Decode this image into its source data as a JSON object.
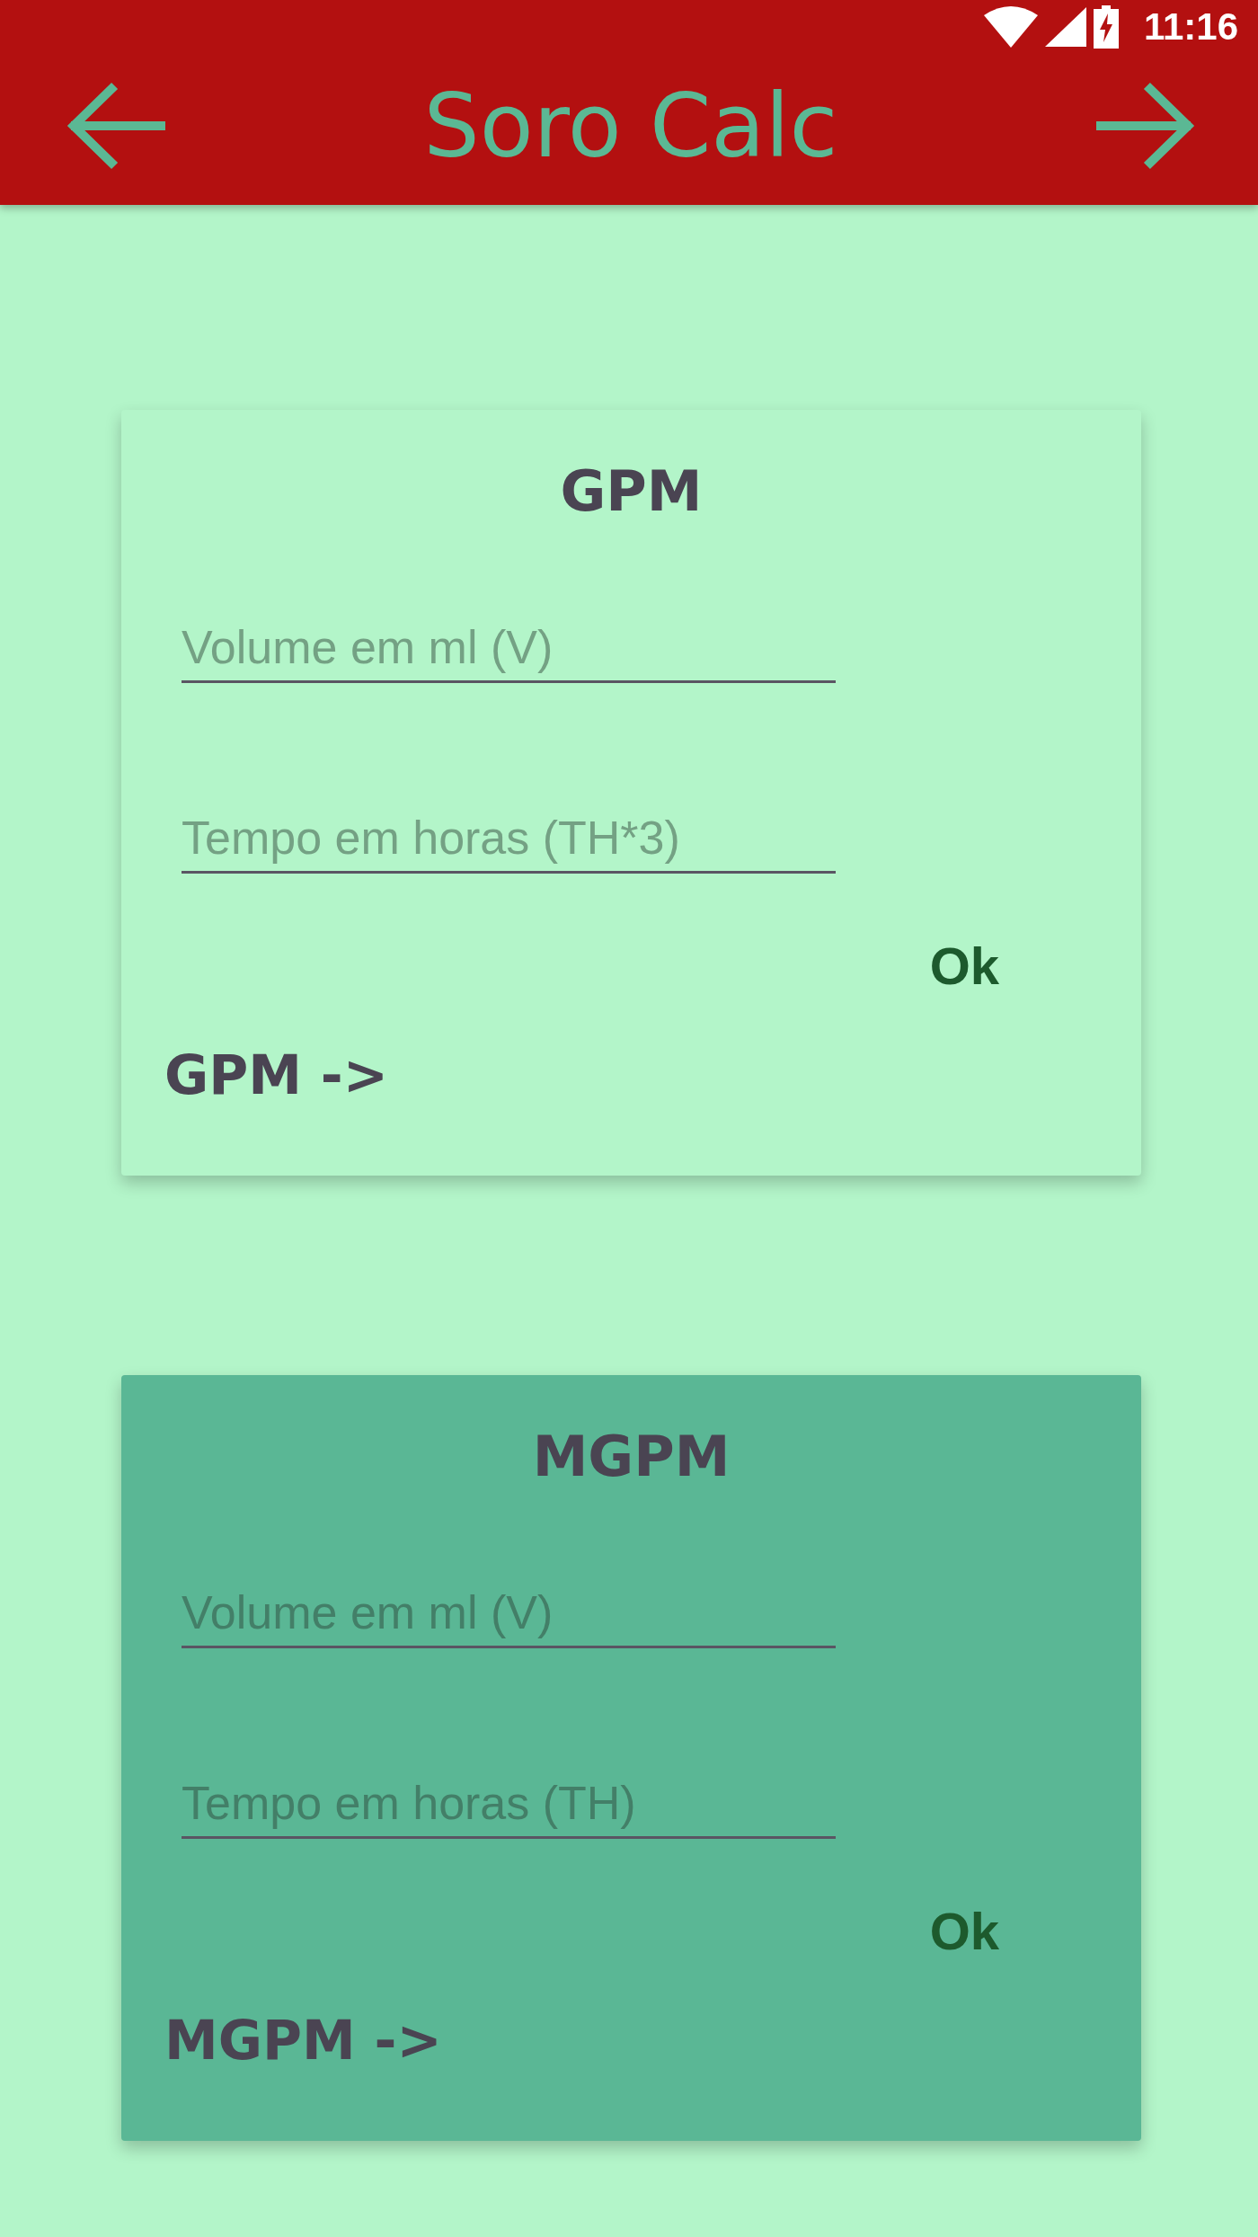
{
  "status_bar": {
    "time": "11:16"
  },
  "app_bar": {
    "title": "Soro Calc"
  },
  "cards": [
    {
      "title": "GPM",
      "color": "#b3f5c9",
      "fields": [
        {
          "placeholder": "Volume em ml (V)"
        },
        {
          "placeholder": "Tempo em horas (TH*3)"
        }
      ],
      "button": "Ok",
      "result": "GPM ->"
    },
    {
      "title": "MGPM",
      "color": "#5ab795",
      "fields": [
        {
          "placeholder": "Volume em ml (V)"
        },
        {
          "placeholder": "Tempo em horas (TH)"
        }
      ],
      "button": "Ok",
      "result": "MGPM ->"
    }
  ]
}
